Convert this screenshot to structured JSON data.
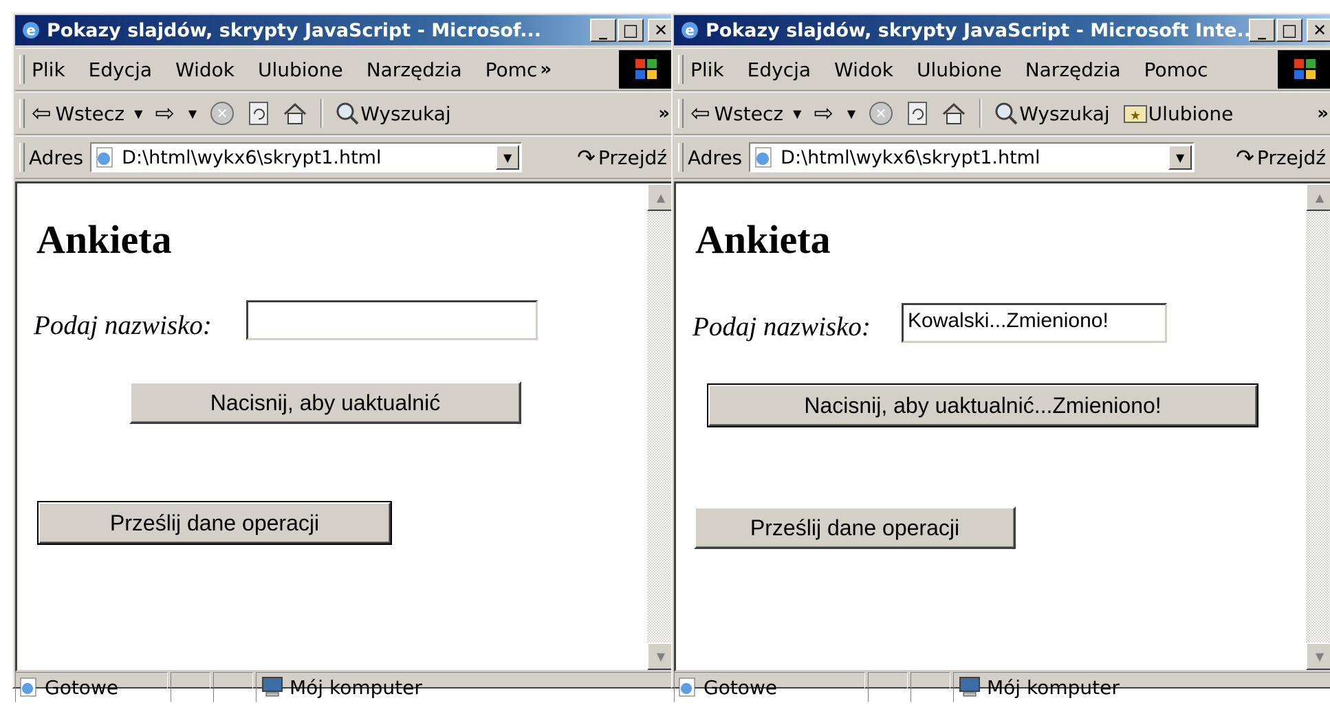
{
  "left_window": {
    "title": "Pokazy slajdów, skrypty JavaScript - Microsof...",
    "menu": [
      "Plik",
      "Edycja",
      "Widok",
      "Ulubione",
      "Narzędzia",
      "Pomc"
    ],
    "toolbar": {
      "back": "Wstecz",
      "search": "Wyszukaj"
    },
    "address": {
      "label": "Adres",
      "value": "D:\\html\\wykx6\\skrypt1.html",
      "go": "Przejdź"
    },
    "page": {
      "heading": "Ankieta",
      "name_label": "Podaj nazwisko:",
      "name_value": "",
      "update_button": "Nacisnij, aby uaktualnić",
      "submit_button": "Prześlij dane operacji"
    },
    "status": {
      "text": "Gotowe",
      "zone": "Mój komputer"
    }
  },
  "right_window": {
    "title": "Pokazy slajdów, skrypty JavaScript - Microsoft Inte...",
    "menu": [
      "Plik",
      "Edycja",
      "Widok",
      "Ulubione",
      "Narzędzia",
      "Pomoc"
    ],
    "toolbar": {
      "back": "Wstecz",
      "search": "Wyszukaj",
      "favorites": "Ulubione"
    },
    "address": {
      "label": "Adres",
      "value": "D:\\html\\wykx6\\skrypt1.html",
      "go": "Przejdź"
    },
    "page": {
      "heading": "Ankieta",
      "name_label": "Podaj nazwisko:",
      "name_value": "Kowalski...Zmieniono!",
      "update_button": "Nacisnij, aby uaktualnić...Zmieniono!",
      "submit_button": "Prześlij dane operacji"
    },
    "status": {
      "text": "Gotowe",
      "zone": "Mój komputer"
    }
  }
}
